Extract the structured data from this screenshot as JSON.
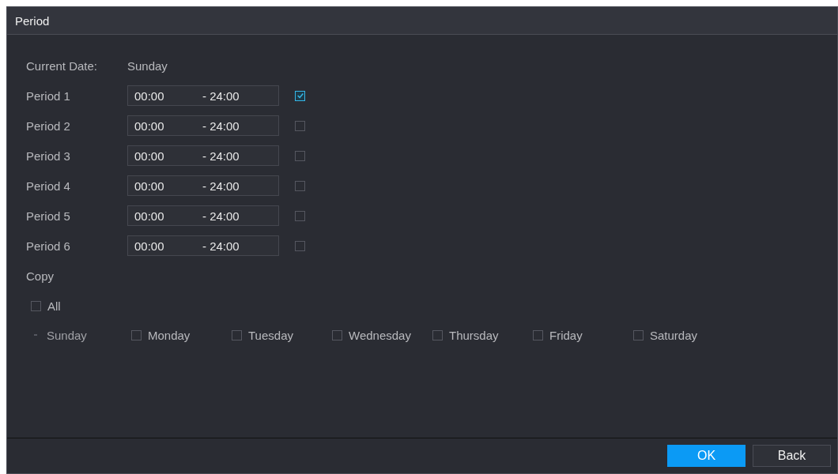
{
  "window": {
    "title": "Period"
  },
  "current_date": {
    "label": "Current Date:",
    "value": "Sunday"
  },
  "periods": [
    {
      "label": "Period 1",
      "start": "00:00",
      "end": "- 24:00",
      "checked": true
    },
    {
      "label": "Period 2",
      "start": "00:00",
      "end": "- 24:00",
      "checked": false
    },
    {
      "label": "Period 3",
      "start": "00:00",
      "end": "- 24:00",
      "checked": false
    },
    {
      "label": "Period 4",
      "start": "00:00",
      "end": "- 24:00",
      "checked": false
    },
    {
      "label": "Period 5",
      "start": "00:00",
      "end": "- 24:00",
      "checked": false
    },
    {
      "label": "Period 6",
      "start": "00:00",
      "end": "- 24:00",
      "checked": false
    }
  ],
  "copy": {
    "label": "Copy",
    "all": {
      "label": "All",
      "checked": false
    },
    "days": [
      {
        "label": "Sunday",
        "disabled": true
      },
      {
        "label": "Monday",
        "checked": false,
        "disabled": false
      },
      {
        "label": "Tuesday",
        "checked": false,
        "disabled": false
      },
      {
        "label": "Wednesday",
        "checked": false,
        "disabled": false
      },
      {
        "label": "Thursday",
        "checked": false,
        "disabled": false
      },
      {
        "label": "Friday",
        "checked": false,
        "disabled": false
      },
      {
        "label": "Saturday",
        "checked": false,
        "disabled": false
      }
    ]
  },
  "buttons": [
    {
      "label": "OK",
      "kind": "primary"
    },
    {
      "label": "Back",
      "kind": "secondary"
    }
  ]
}
